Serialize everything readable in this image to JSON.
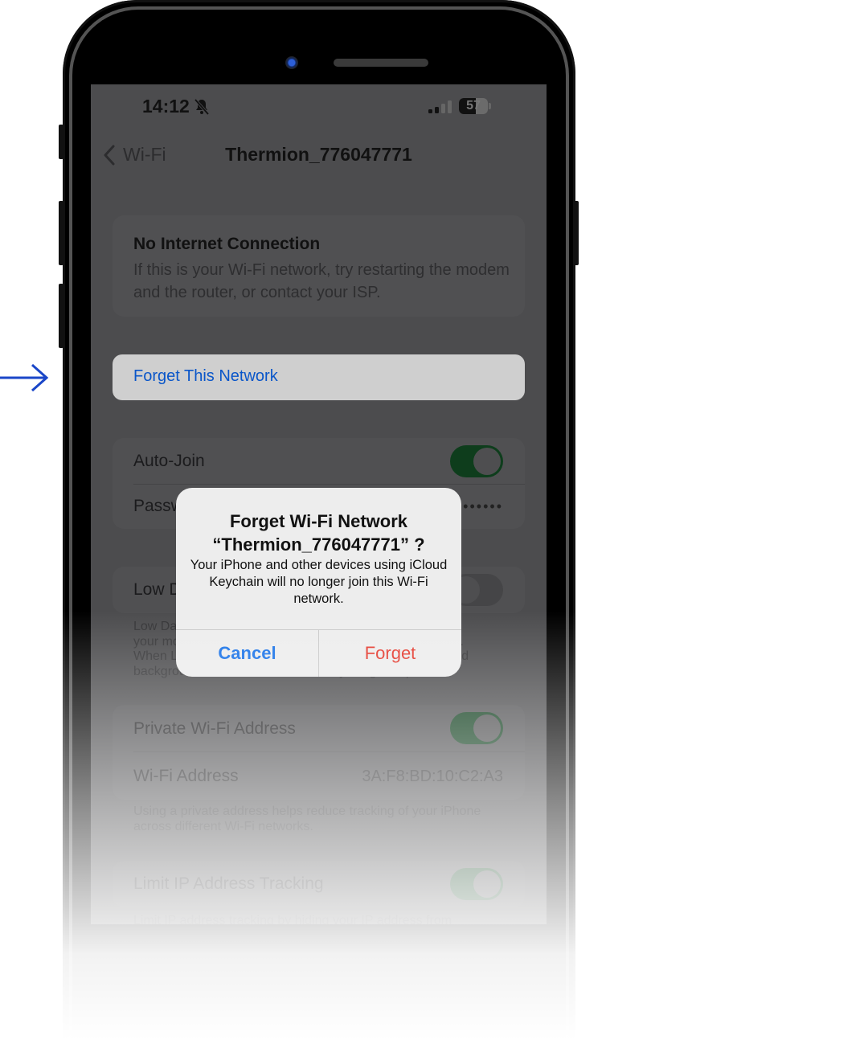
{
  "status_bar": {
    "time": "14:12",
    "silent_icon": "bell-slash-icon",
    "signal_icon": "cellular-signal-icon",
    "battery_percent": "57"
  },
  "nav": {
    "back_label": "Wi-Fi",
    "title": "Thermion_776047771"
  },
  "info_card": {
    "title": "No Internet Connection",
    "body": "If this is your Wi-Fi network, try restarting the modem and the router, or contact your ISP."
  },
  "forget_network": {
    "label": "Forget This Network"
  },
  "settings": {
    "auto_join_label": "Auto-Join",
    "auto_join_on": true,
    "password_label": "Password",
    "password_mask": "•••••••••••",
    "low_data_label": "Low Data Mode",
    "low_data_on": false,
    "low_data_footnote_lines": [
      "Low Data Mode helps reduce Wi-Fi data usage over",
      "your mobile network or specific Wi-Fi networks you select.",
      "When Low Data Mode is turned on, automatic updates and",
      "background tasks, such as Photos syncing, are paused."
    ],
    "private_address_label": "Private Wi-Fi Address",
    "private_address_on": true,
    "wifi_address_label": "Wi-Fi Address",
    "wifi_address_value": "3A:F8:BD:10:C2:A3",
    "private_footnote": "Using a private address helps reduce tracking of your iPhone across different Wi-Fi networks.",
    "limit_ip_label": "Limit IP Address Tracking",
    "limit_ip_on": true,
    "limit_ip_footnote": "Limit IP address tracking by hiding your IP address from"
  },
  "alert": {
    "title_line1": "Forget Wi-Fi Network",
    "title_line2": "“Thermion_776047771” ?",
    "message": "Your iPhone and other devices using iCloud Keychain will no longer join this Wi-Fi network.",
    "cancel_label": "Cancel",
    "forget_label": "Forget"
  },
  "colors": {
    "accent_blue": "#1a73e8",
    "destructive_red": "#e53a2e",
    "pointer_arrow": "#1a46c8"
  }
}
